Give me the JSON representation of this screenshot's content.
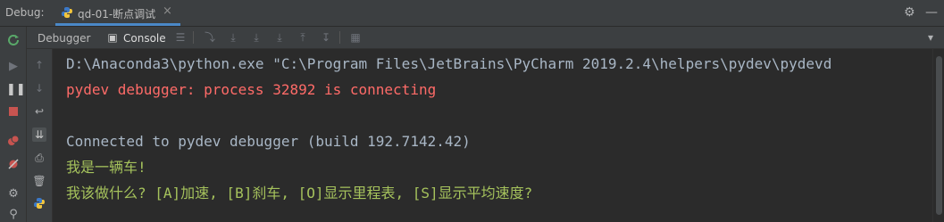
{
  "debug_label": "Debug:",
  "tab": {
    "title": "qd-01-断点调试",
    "close": "×"
  },
  "title_icons": {
    "settings": "⚙",
    "minimize": "—"
  },
  "toolbar": {
    "debugger_tab": "Debugger",
    "console_tab": "Console"
  },
  "console": {
    "lines": [
      "D:\\Anaconda3\\python.exe \"C:\\Program Files\\JetBrains\\PyCharm 2019.2.4\\helpers\\pydev\\pydevd",
      "pydev debugger: process 32892 is connecting",
      "",
      "Connected to pydev debugger (build 192.7142.42)",
      "我是一辆车!",
      "我该做什么? [A]加速, [B]刹车, [O]显示里程表, [S]显示平均速度?"
    ]
  },
  "colors": {
    "background": "#2b2b2b",
    "panel": "#3c3f41",
    "text_default": "#a9b7c6",
    "text_error": "#ff6b68",
    "text_input": "#a5c25c",
    "accent": "#4a88c7"
  }
}
